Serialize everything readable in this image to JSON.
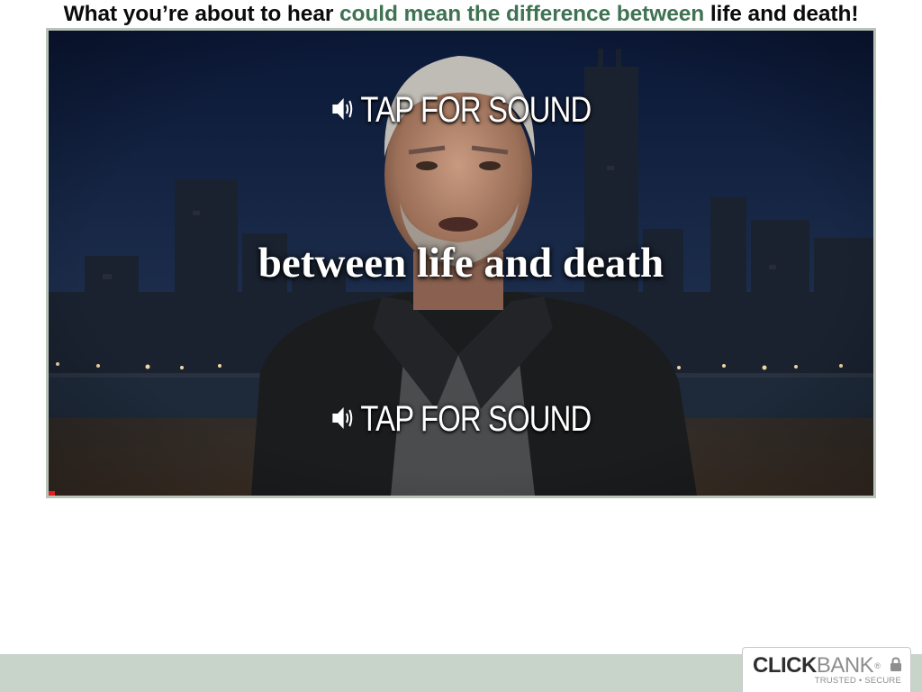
{
  "headline": {
    "part1": "What you’re about to hear ",
    "accent": "could mean the difference between",
    "part2": " life and death!",
    "accent_color": "#3f7353"
  },
  "video": {
    "sound_prompt_top": "TAP FOR SOUND",
    "sound_prompt_bottom": "TAP FOR SOUND",
    "caption": "between life and death",
    "speaker_icon": "speaker-icon",
    "progress_color": "#e02020",
    "frame_border_color": "#b9c3b8"
  },
  "footer": {
    "bar_color": "#c8d3ca",
    "badge": {
      "brand_bold": "CLICK",
      "brand_light": "BANK",
      "registered": "®",
      "tagline": "TRUSTED • SECURE",
      "lock_icon": "lock-icon"
    }
  }
}
